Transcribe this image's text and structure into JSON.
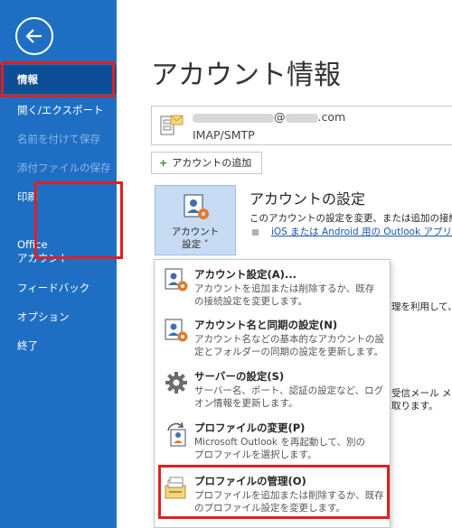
{
  "sidebar": {
    "items": [
      {
        "label": "情報"
      },
      {
        "label": "開く/エクスポート"
      },
      {
        "label": "名前を付けて保存"
      },
      {
        "label": "添付ファイルの保存"
      },
      {
        "label": "印刷"
      },
      {
        "label": "Office",
        "label2": "アカウント"
      },
      {
        "label": "フィードバック"
      },
      {
        "label": "オプション"
      },
      {
        "label": "終了"
      }
    ]
  },
  "main": {
    "title": "アカウント情報",
    "account": {
      "email_suffix": "@",
      "email_domain": ".com",
      "type": "IMAP/SMTP"
    },
    "add_account_label": "アカウントの追加",
    "settings_button": {
      "line1": "アカウント",
      "line2": "設定 ˅"
    },
    "section_title": "アカウントの設定",
    "section_desc": "このアカウントの設定を変更、または追加の接続を",
    "ios_link": "iOS または Android 用の Outlook アプリ",
    "bg_text1": "理を利用して、",
    "bg_text2": "受信メール メッセ",
    "bg_text3": "取ります。"
  },
  "dropdown": {
    "items": [
      {
        "title": "アカウント設定(A)...",
        "desc1": "アカウントを追加または削除するか、既存",
        "desc2": "の接続設定を変更します。",
        "icon": "account-settings-icon"
      },
      {
        "title": "アカウント名と同期の設定(N)",
        "desc1": "アカウント名などの基本的なアカウントの設",
        "desc2": "定とフォルダーの同期の設定を更新します。",
        "icon": "account-name-sync-icon"
      },
      {
        "title": "サーバーの設定(S)",
        "desc1": "サーバー名、ポート、認証の設定など、ログ",
        "desc2": "オン情報を更新します。",
        "icon": "gear-icon"
      },
      {
        "title": "プロファイルの変更(P)",
        "desc1": "Microsoft Outlook を再起動して、別の",
        "desc2": "プロファイルを選択します。",
        "icon": "change-profile-icon"
      },
      {
        "title": "プロファイルの管理(O)",
        "desc1": "プロファイルを追加または削除するか、既存",
        "desc2": "のプロファイル設定を変更します。",
        "icon": "manage-profile-icon"
      }
    ]
  },
  "colors": {
    "sidebar_bg": "#1e6fc3",
    "sidebar_selected": "#0d4f96",
    "highlight": "#e02020",
    "link": "#1a56b0"
  }
}
